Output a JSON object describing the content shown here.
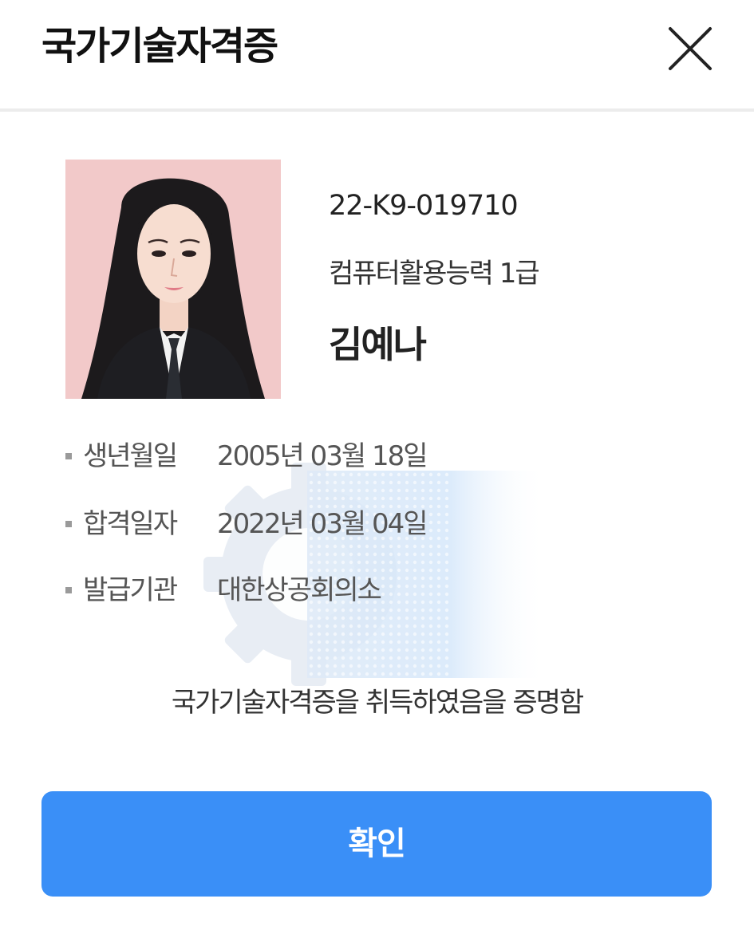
{
  "header": {
    "title": "국가기술자격증",
    "close_icon": "close-icon"
  },
  "certificate": {
    "number": "22-K9-019710",
    "type": "컴퓨터활용능력 1급",
    "name": "김예나",
    "fields": [
      {
        "label": "생년월일",
        "value": "2005년 03월 18일"
      },
      {
        "label": "합격일자",
        "value": "2022년 03월 04일"
      },
      {
        "label": "발급기관",
        "value": "대한상공회의소"
      }
    ],
    "statement": "국가기술자격증을 취득하였음을 증명함"
  },
  "actions": {
    "confirm_label": "확인"
  },
  "colors": {
    "accent": "#3a8ff7",
    "photo_background": "#f2c9c9",
    "divider": "#ececec"
  }
}
